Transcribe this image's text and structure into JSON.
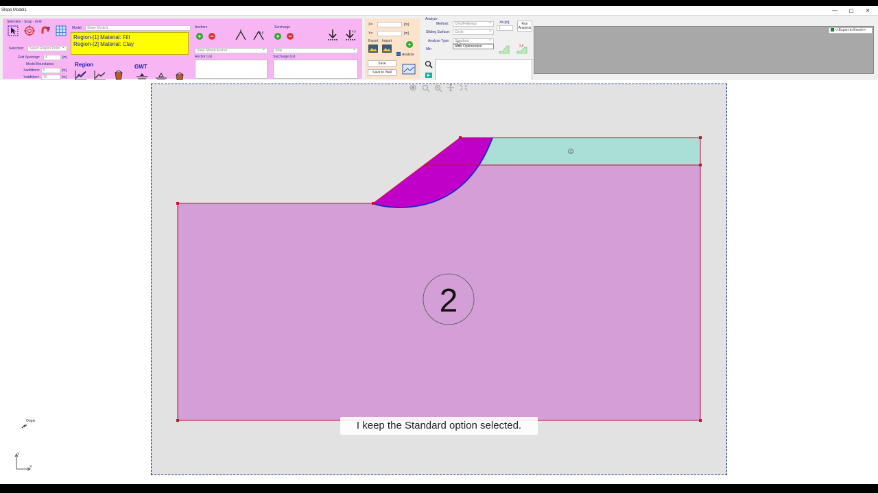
{
  "window": {
    "title": "Slope Model1",
    "minimize": "—",
    "maximize": "▢",
    "close": "✕"
  },
  "ribbon": {
    "selection_group_title": "Selection - Snap - Grid",
    "selection_label": "Selection:",
    "selection_value": "Select Region Point",
    "grid_spacing_label": "Grid Spacing=",
    "grid_spacing_value": "4",
    "unit_m": "[m]",
    "model_boundaries_label": "Model Boundaries",
    "xaddition_label": "Xaddition=",
    "xaddition_value": "5",
    "yaddition_label": "Yaddition=",
    "yaddition_value": "10",
    "model_label": "Model",
    "model_value": "Slope Model1",
    "regions": [
      "Region-[1] Material: Fill",
      "Region-[2] Material: Clay"
    ],
    "region_section": "Region",
    "gwt_section": "GWT",
    "anchors_label": "Anchors",
    "anchor_type": "Steel Strand Anchor",
    "anchor_list_label": "Anchor List",
    "surcharge_label": "Surcharge",
    "surcharge_type": "Strip",
    "surcharge_list_label": "Surcharge List",
    "x_label": "X=",
    "y_label": "Y=",
    "export_label": "Export",
    "import_label": "Import",
    "analyze_checkbox": "Analyze",
    "save_button": "Save",
    "save_to_wall_button": "Save to Wall",
    "analyze_group_title": "Analyze",
    "method_label": "Method:",
    "method_value": "Oms/Fellenius",
    "sliding_surface_label": "Sliding Surface:",
    "sliding_surface_value": "Circle",
    "analyze_type_label": "Analyze Type:",
    "analyze_type_value": "Standard",
    "dropdown_option": "After Optimization",
    "min_label": "Min",
    "xb_label": "Xb [m]",
    "xb_value": "1",
    "run_analysis_button": "Run Analysis",
    "export_excel_button": "<<Export to Excel>>"
  },
  "canvas": {
    "region1_label": "1",
    "region2_label": "2",
    "origin_label": "Origin",
    "axis_y": "Y",
    "axis_x": "X",
    "colors": {
      "region1": "#a9dfd6",
      "region2": "#d49ed6",
      "slip_mass": "#c000c8",
      "boundary": "#c8102e",
      "slip_line": "#1a28c8"
    }
  },
  "caption": "I keep the Standard option selected."
}
